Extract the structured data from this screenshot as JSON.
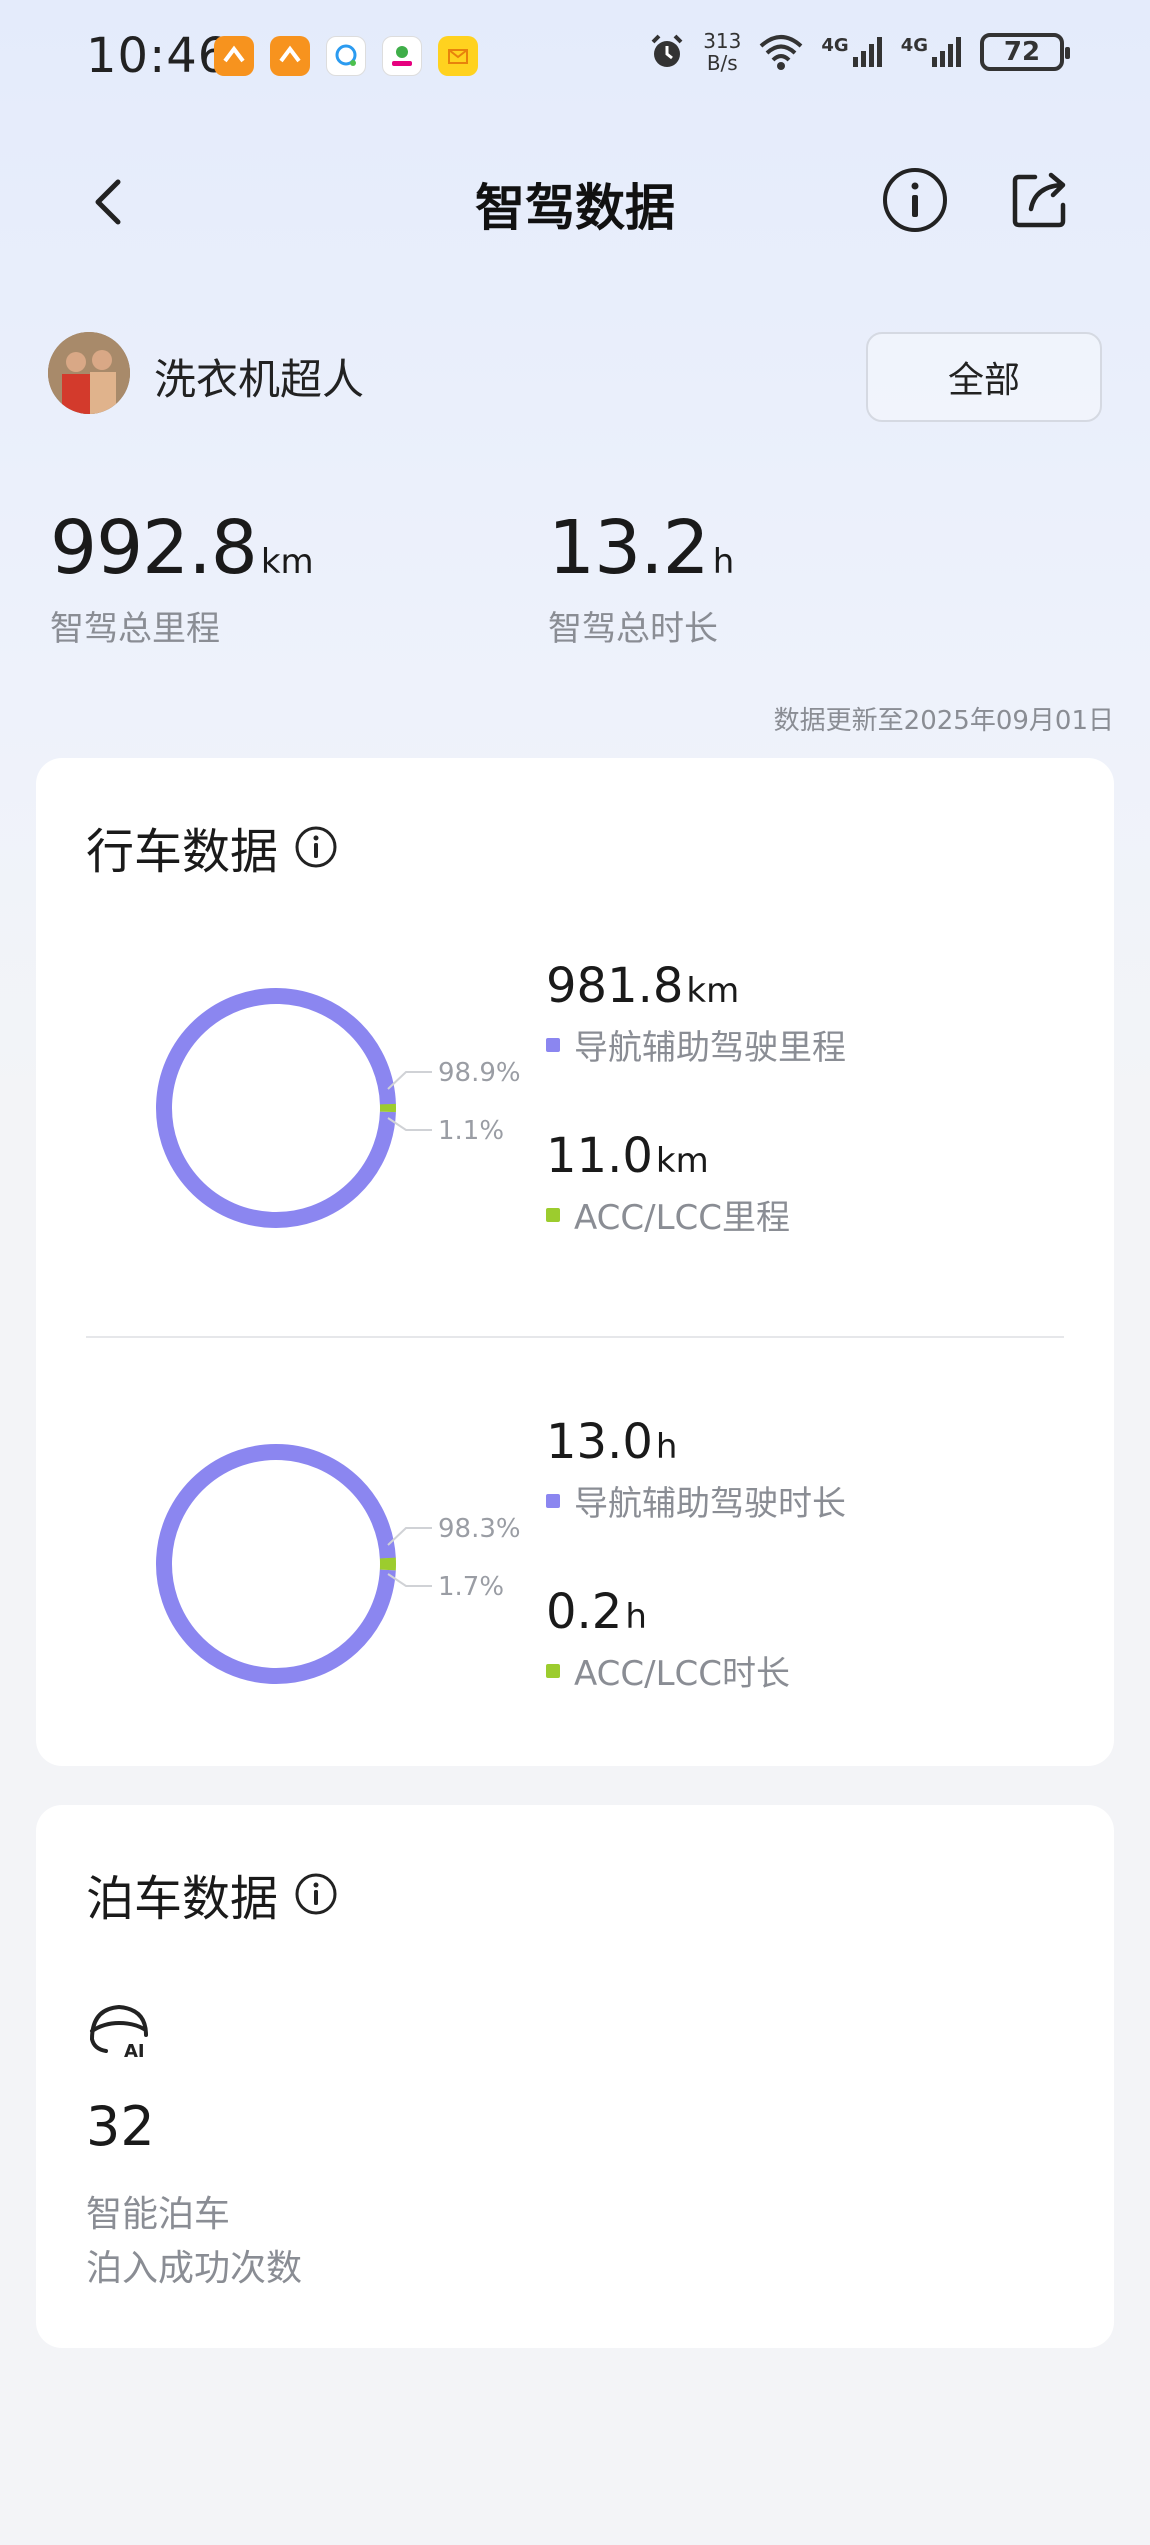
{
  "status_bar": {
    "time": "10:46",
    "net_speed_value": "313",
    "net_speed_unit": "B/s",
    "signal1": "4G",
    "signal2": "4G",
    "battery": "72"
  },
  "nav": {
    "title": "智驾数据"
  },
  "user": {
    "name": "洗衣机超人",
    "filter_label": "全部"
  },
  "summary": {
    "mileage": {
      "value": "992.8",
      "unit": "km",
      "label": "智驾总里程"
    },
    "duration": {
      "value": "13.2",
      "unit": "h",
      "label": "智驾总时长"
    },
    "update_note": "数据更新至2025年09月01日"
  },
  "driving": {
    "title": "行车数据",
    "mileage": {
      "ring": {
        "primary_pct": 98.9,
        "secondary_pct": 1.1,
        "primary_label": "98.9%",
        "secondary_label": "1.1%"
      },
      "items": [
        {
          "value": "981.8",
          "unit": "km",
          "label": "导航辅助驾驶里程"
        },
        {
          "value": "11.0",
          "unit": "km",
          "label": "ACC/LCC里程"
        }
      ]
    },
    "duration": {
      "ring": {
        "primary_pct": 98.3,
        "secondary_pct": 1.7,
        "primary_label": "98.3%",
        "secondary_label": "1.7%"
      },
      "items": [
        {
          "value": "13.0",
          "unit": "h",
          "label": "导航辅助驾驶时长"
        },
        {
          "value": "0.2",
          "unit": "h",
          "label": "ACC/LCC时长"
        }
      ]
    }
  },
  "parking": {
    "title": "泊车数据",
    "icon_text": "AI",
    "count": "32",
    "label": "智能泊车",
    "sublabel": "泊入成功次数"
  },
  "colors": {
    "primary": "#8b86f0",
    "secondary": "#9ccc2e",
    "leader": "#d0d2d6"
  }
}
